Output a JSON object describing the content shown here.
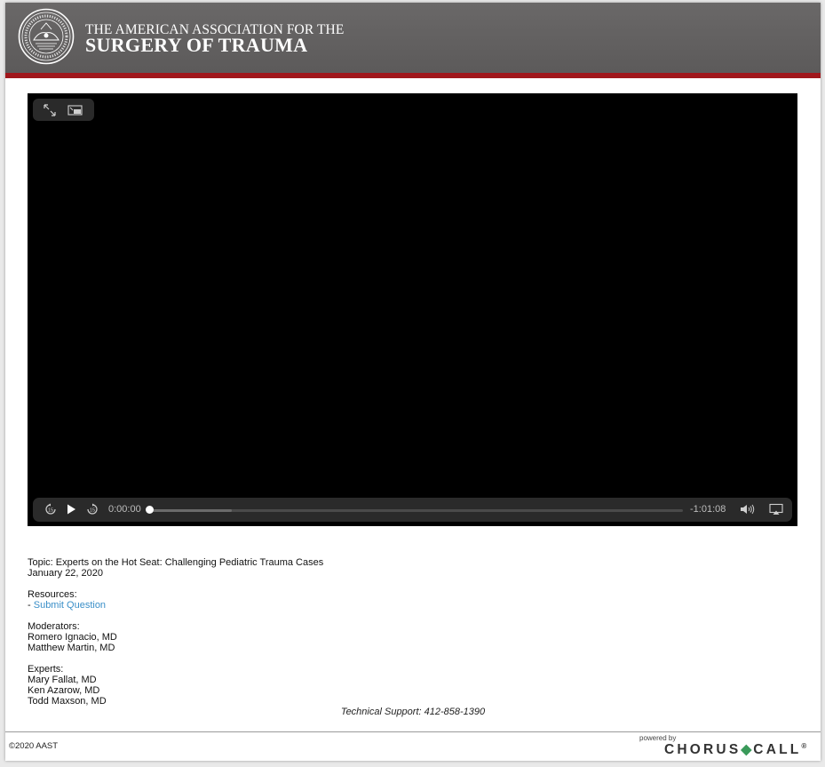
{
  "header": {
    "logo_line1": "THE AMERICAN ASSOCIATION FOR THE",
    "logo_line2": "SURGERY OF TRAUMA",
    "seal_icon": "aast-seal-icon",
    "background_color": "#5f5d5d",
    "accent_color": "#a0171c"
  },
  "player": {
    "top_controls": [
      {
        "icon": "fullscreen-icon"
      },
      {
        "icon": "picture-in-picture-icon"
      }
    ],
    "controls": {
      "skip_back_icon": "skip-back-15-icon",
      "play_icon": "play-icon",
      "skip_forward_icon": "skip-forward-15-icon",
      "elapsed": "0:00:00",
      "remaining": "-1:01:08",
      "progress": 0,
      "buffered": 0.15,
      "volume_icon": "volume-icon",
      "airplay_icon": "airplay-icon"
    }
  },
  "info": {
    "topic": "Topic: Experts on the Hot Seat: Challenging Pediatric Trauma Cases",
    "date": "January 22, 2020",
    "resources_heading": "Resources:",
    "resource_prefix": "- ",
    "resource_link": "Submit Question",
    "moderators_heading": "Moderators:",
    "moderators": [
      "Romero Ignacio, MD",
      "Matthew Martin, MD"
    ],
    "experts_heading": "Experts:",
    "experts": [
      "Mary Fallat, MD",
      "Ken Azarow, MD",
      "Todd Maxson, MD"
    ]
  },
  "support": "Technical Support: 412-858-1390",
  "footer": {
    "copyright": "©2020 AAST",
    "powered_by": "powered by",
    "brand_left": "CHORUS",
    "brand_right": "CALL",
    "brand_mark": "®"
  }
}
